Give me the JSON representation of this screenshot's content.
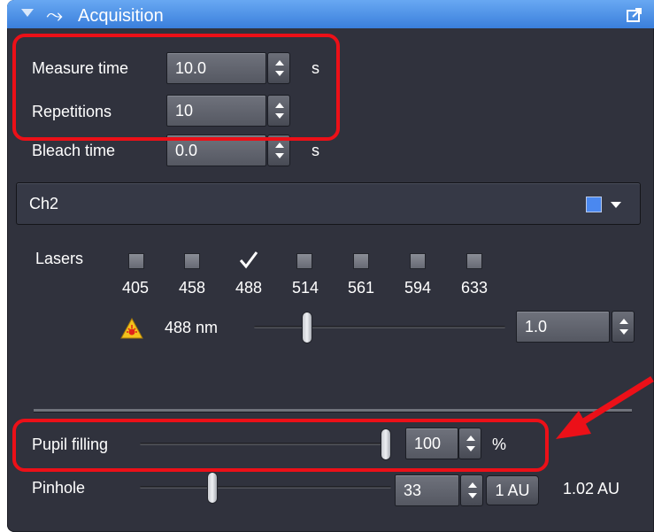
{
  "panel": {
    "title": "Acquisition",
    "icons": [
      "collapse-triangle-icon",
      "loop-icon",
      "popout-icon"
    ]
  },
  "fields": {
    "measure_time": {
      "label": "Measure time",
      "value": "10.0",
      "unit": "s"
    },
    "repetitions": {
      "label": "Repetitions",
      "value": "10"
    },
    "bleach_time": {
      "label": "Bleach time",
      "value": "0.0",
      "unit": "s"
    }
  },
  "channel": {
    "name": "Ch2",
    "color": "#4a88f0"
  },
  "lasers": {
    "label": "Lasers",
    "items": [
      {
        "wavelength": "405",
        "checked": false
      },
      {
        "wavelength": "458",
        "checked": false
      },
      {
        "wavelength": "488",
        "checked": true
      },
      {
        "wavelength": "514",
        "checked": false
      },
      {
        "wavelength": "561",
        "checked": false
      },
      {
        "wavelength": "594",
        "checked": false
      },
      {
        "wavelength": "633",
        "checked": false
      }
    ],
    "active": {
      "label": "488 nm",
      "value": "1.0",
      "slider_fraction": 0.2
    }
  },
  "pupil": {
    "label": "Pupil filling",
    "value": "100",
    "unit": "%",
    "slider_fraction": 1.0
  },
  "pinhole": {
    "label": "Pinhole",
    "value": "33",
    "button": "1 AU",
    "readout": "1.02 AU",
    "slider_fraction": 0.28
  },
  "colors": {
    "titlebar": "#3a7fdc",
    "panel_bg": "#30323d",
    "highlight": "#ec1018"
  }
}
